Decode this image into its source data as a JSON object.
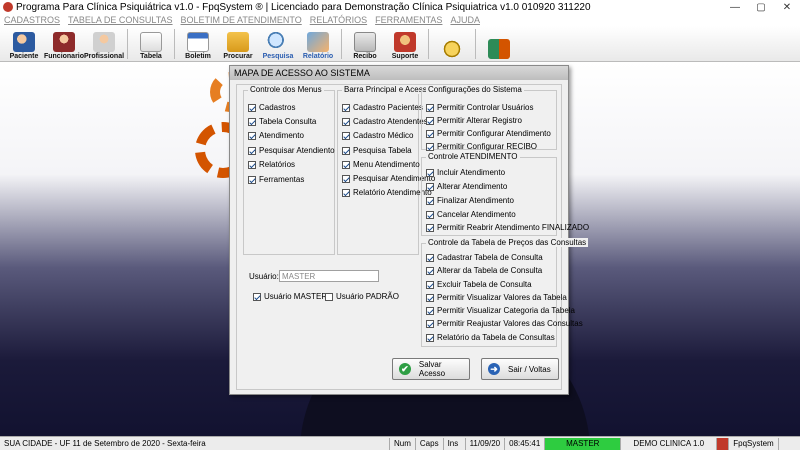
{
  "window": {
    "title": "Programa Para Clínica Psiquiátrica v1.0 - FpqSystem ® | Licenciado para  Demonstração Clínica Psiquiatrica v1.0 010920 311220",
    "min": "—",
    "max": "▢",
    "close": "✕"
  },
  "menu": [
    "CADASTROS",
    "TABELA DE CONSULTAS",
    "BOLETIM DE ATENDIMENTO",
    "RELATÓRIOS",
    "FERRAMENTAS",
    "AJUDA"
  ],
  "toolbar": {
    "paciente": "Paciente",
    "funcionario": "Funcionario",
    "profissional": "Profissional",
    "tabela": "Tabela",
    "boletim": "Boletim",
    "procurar": "Procurar",
    "pesquisa": "Pesquisa",
    "relatorio": "Relatório",
    "recibo": "Recibo",
    "suporte": "Suporte"
  },
  "dialog": {
    "title": "MAPA DE ACESSO AO SISTEMA",
    "menus": {
      "title": "Controle dos Menus",
      "items": [
        "Cadastros",
        "Tabela Consulta",
        "Atendimento",
        "Pesquisar Atendiento",
        "Relatórios",
        "Ferramentas"
      ]
    },
    "barra": {
      "title": "Barra Principal e Acessos",
      "items": [
        "Cadastro Pacientes",
        "Cadastro Atendentes",
        "Cadastro Médico",
        "Pesquisa Tabela",
        "Menu Atendimento",
        "Pesquisar Atendimento",
        "Relatório Atendimento"
      ]
    },
    "config": {
      "title": "Configurações do Sistema",
      "items": [
        "Permitir Controlar Usuários",
        "Permitir Alterar Registro",
        "Permitir Configurar Atendimento",
        "Permitir Configurar RECIBO"
      ]
    },
    "atendimento": {
      "title": "Controle ATENDIMENTO",
      "items": [
        "Incluir Atendimento",
        "Alterar Atendimento",
        "Finalizar Atendimento",
        "Cancelar Atendimento",
        "Permitir Reabrir Atendimento FINALIZADO"
      ]
    },
    "precos": {
      "title": "Controle da Tabela de Preços das Consultas",
      "items": [
        "Cadastrar Tabela de Consulta",
        "Alterar da Tabela de Consulta",
        "Excluir Tabela de Consulta",
        "Permitir Visualizar Valores da Tabela",
        "Permitir Visualizar Categoria da Tabela",
        "Permitir Reajustar Valores das Consultas",
        "Relatório da Tabela de Consultas"
      ]
    },
    "usuario_label": "Usuário:",
    "usuario_value": "MASTER",
    "usuario_master": "Usuário MASTER",
    "usuario_padrao": "Usuário PADRÃO",
    "save_button": "Salvar Acesso",
    "exit_button": "Sair / Voltas"
  },
  "status": {
    "city": "SUA CIDADE - UF 11 de Setembro de 2020 - Sexta-feira",
    "num": "Num",
    "caps": "Caps",
    "ins": "Ins",
    "date": "11/09/20",
    "time": "08:45:41",
    "user": "MASTER",
    "clinic": "DEMO CLINICA 1.0",
    "brand": "FpqSystem"
  }
}
